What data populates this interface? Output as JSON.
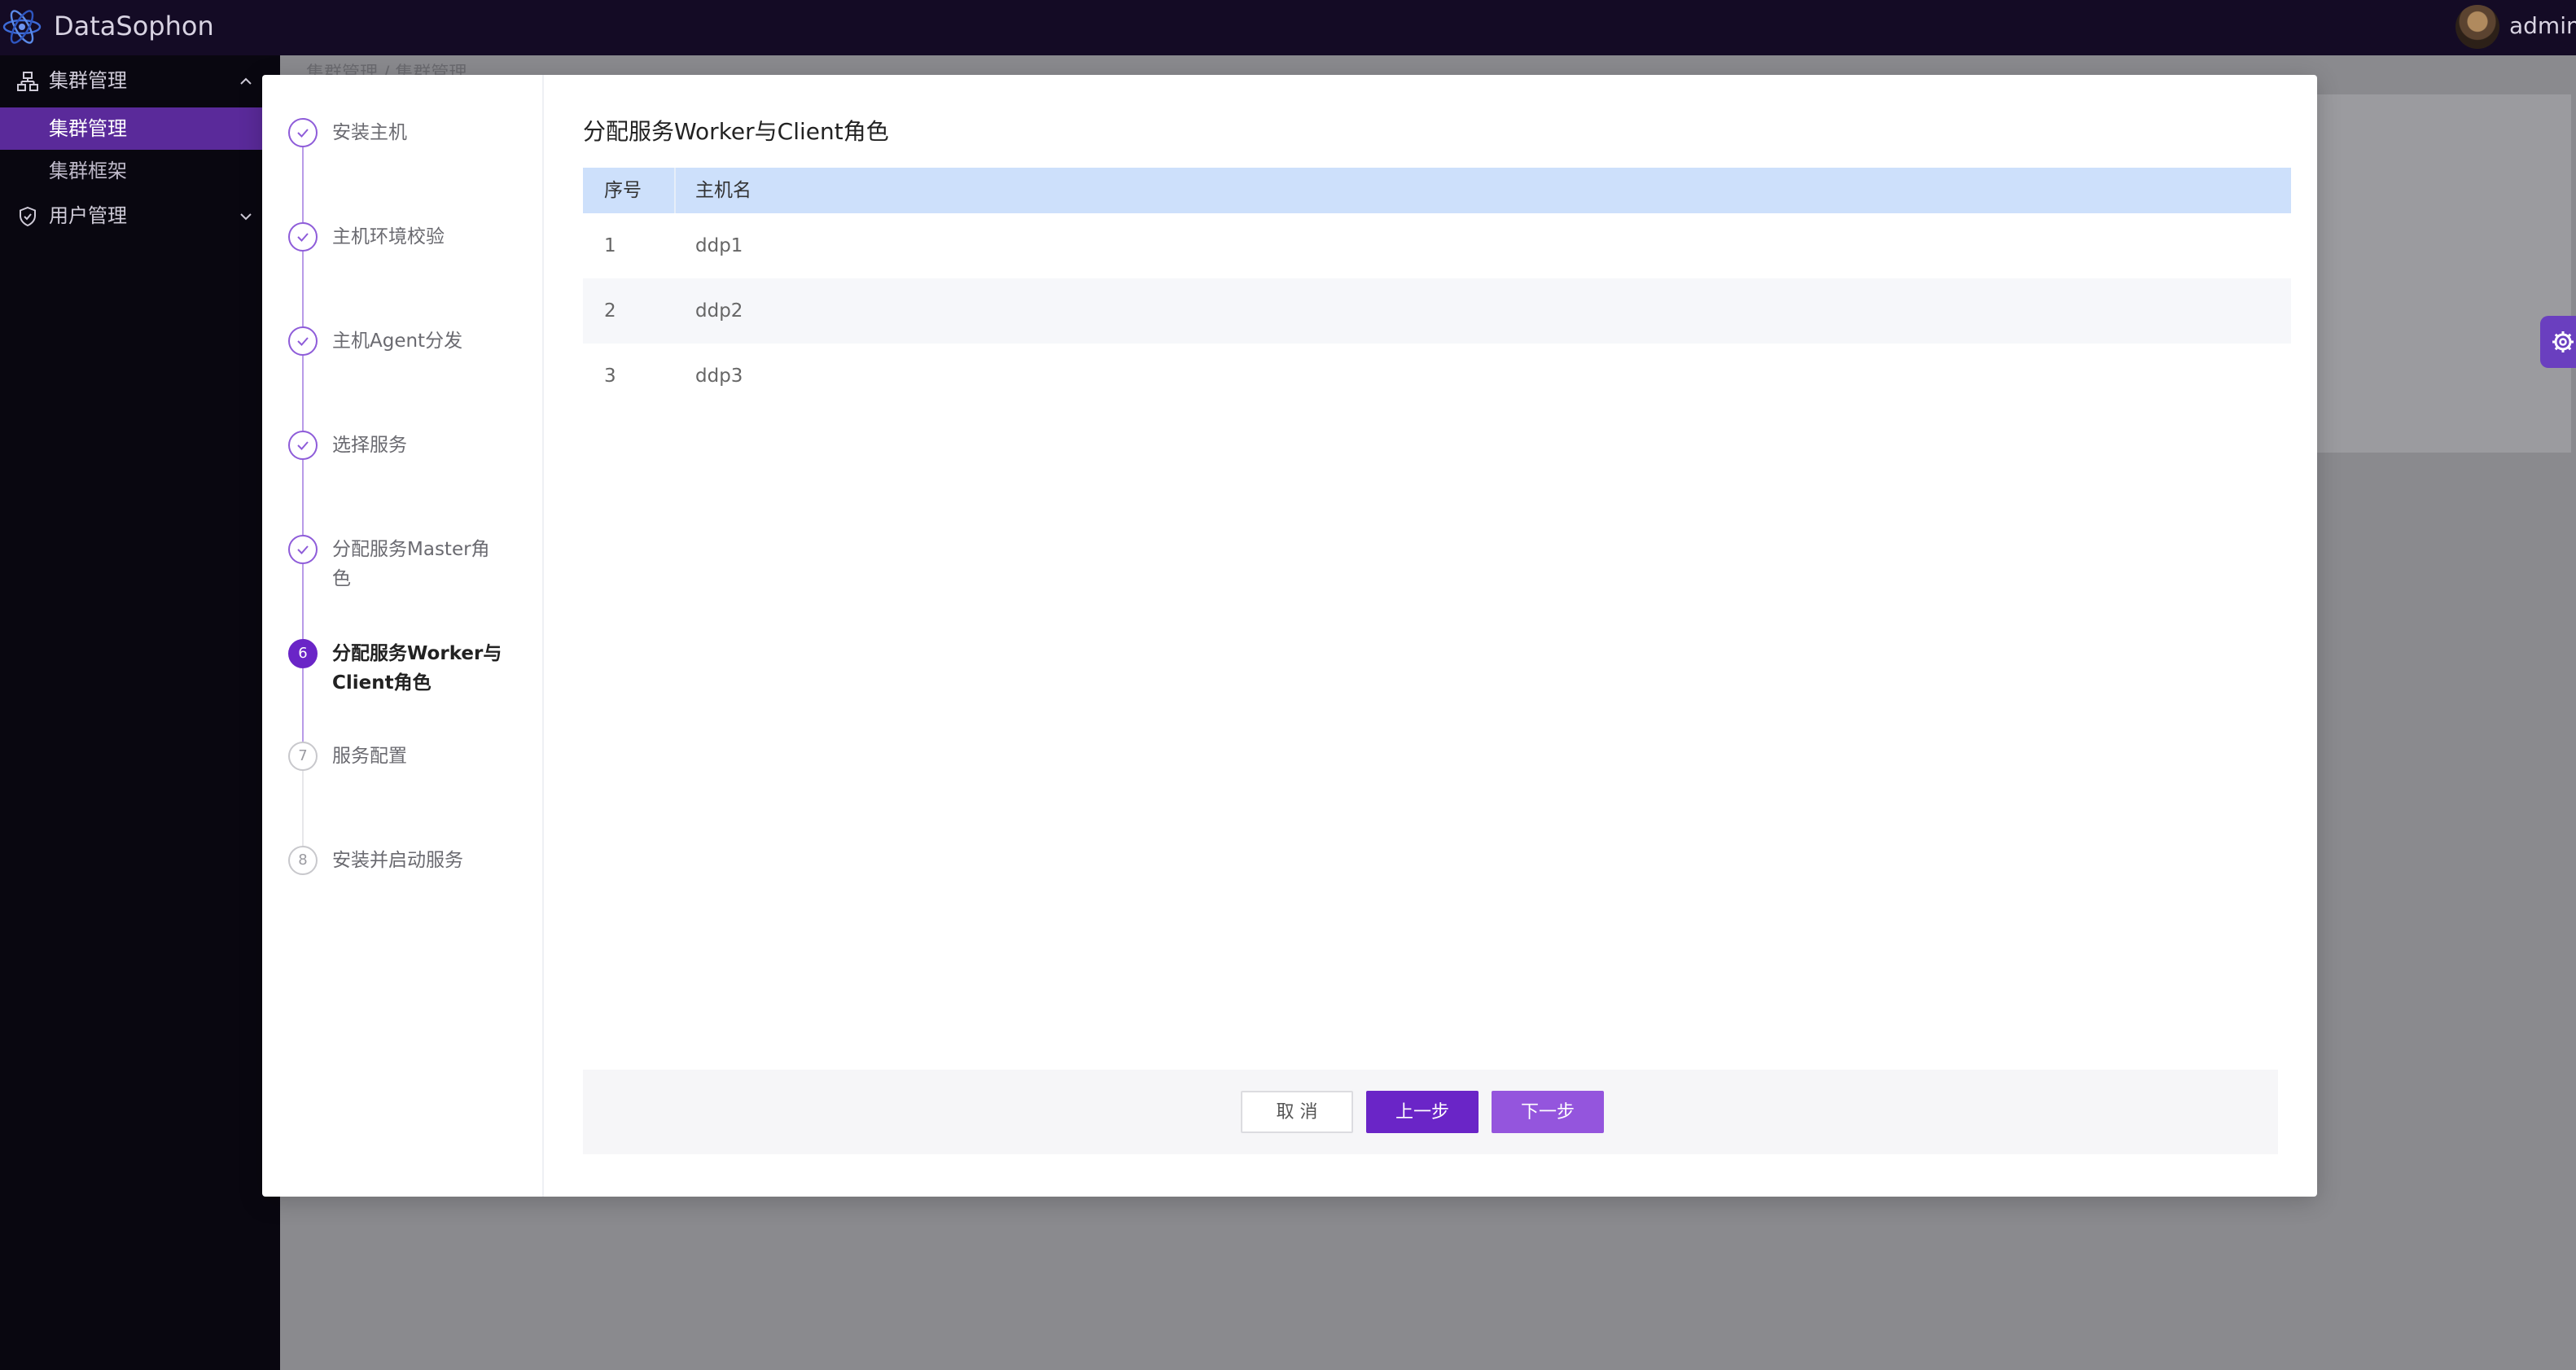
{
  "app": {
    "brand": "DataSophon",
    "user": "admin"
  },
  "sidebar": {
    "groups": [
      {
        "label": "集群管理",
        "expanded": true,
        "items": [
          {
            "label": "集群管理",
            "active": true
          },
          {
            "label": "集群框架",
            "active": false
          }
        ]
      },
      {
        "label": "用户管理",
        "expanded": false
      }
    ]
  },
  "background": {
    "breadcrumb": "集群管理 / 集群管理"
  },
  "wizard": {
    "steps": [
      {
        "label": "安装主机",
        "status": "done"
      },
      {
        "label": "主机环境校验",
        "status": "done"
      },
      {
        "label": "主机Agent分发",
        "status": "done"
      },
      {
        "label": "选择服务",
        "status": "done"
      },
      {
        "label": "分配服务Master角色",
        "status": "done"
      },
      {
        "number": "6",
        "label": "分配服务Worker与Client角色",
        "status": "active"
      },
      {
        "number": "7",
        "label": "服务配置",
        "status": "todo"
      },
      {
        "number": "8",
        "label": "安装并启动服务",
        "status": "todo"
      }
    ],
    "title": "分配服务Worker与Client角色",
    "table": {
      "headers": [
        "序号",
        "主机名"
      ],
      "rows": [
        [
          "1",
          "ddp1"
        ],
        [
          "2",
          "ddp2"
        ],
        [
          "3",
          "ddp3"
        ]
      ]
    },
    "buttons": {
      "cancel": "取 消",
      "prev": "上一步",
      "next": "下一步"
    }
  },
  "colors": {
    "accent": "#6a25c7",
    "header_bg": "#140b25",
    "sidebar_bg": "#090710",
    "active_menu": "#5a2a9a",
    "table_header": "#cde0fb"
  }
}
